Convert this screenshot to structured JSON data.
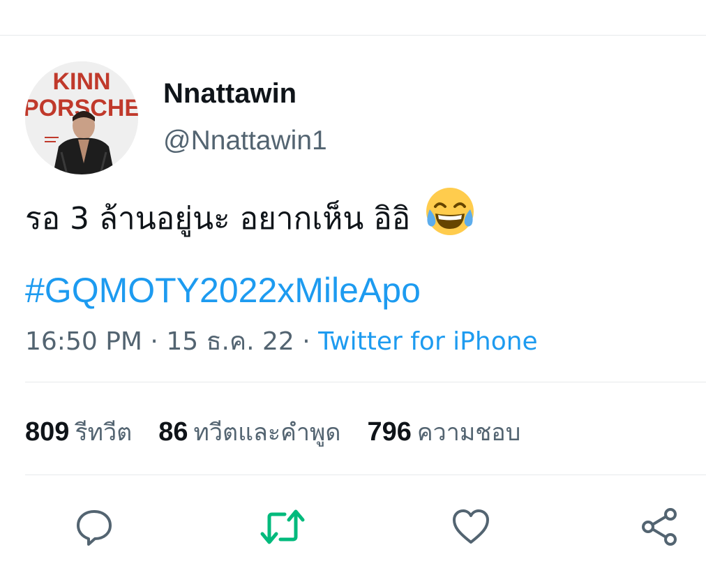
{
  "tweet": {
    "avatar": {
      "alt": "profile picture",
      "poster_line1": "KINN",
      "poster_line2": "PORSCHE"
    },
    "display_name": "Nnattawin",
    "handle": "@Nnattawin1",
    "text": "รอ 3 ล้านอยู่นะ อยากเห็น อิอิ",
    "emoji": "face-with-tears-of-joy",
    "hashtag": "#GQMOTY2022xMileApo",
    "time": "16:50 PM",
    "separator": "·",
    "date": "15 ธ.ค. 22",
    "source": "Twitter for iPhone"
  },
  "stats": {
    "retweets_count": "809",
    "retweets_label": "รีทวีต",
    "quotes_count": "86",
    "quotes_label": "ทวีตและคำพูด",
    "likes_count": "796",
    "likes_label": "ความชอบ"
  },
  "actions": [
    {
      "name": "reply",
      "icon": "speech-bubble-icon"
    },
    {
      "name": "retweet",
      "icon": "retweet-icon"
    },
    {
      "name": "like",
      "icon": "heart-icon"
    },
    {
      "name": "share",
      "icon": "share-icon"
    }
  ],
  "colors": {
    "link": "#1d9bf0",
    "secondary_text": "#536471",
    "retweet_active": "#00ba7c",
    "divider": "#e6e9eb"
  }
}
